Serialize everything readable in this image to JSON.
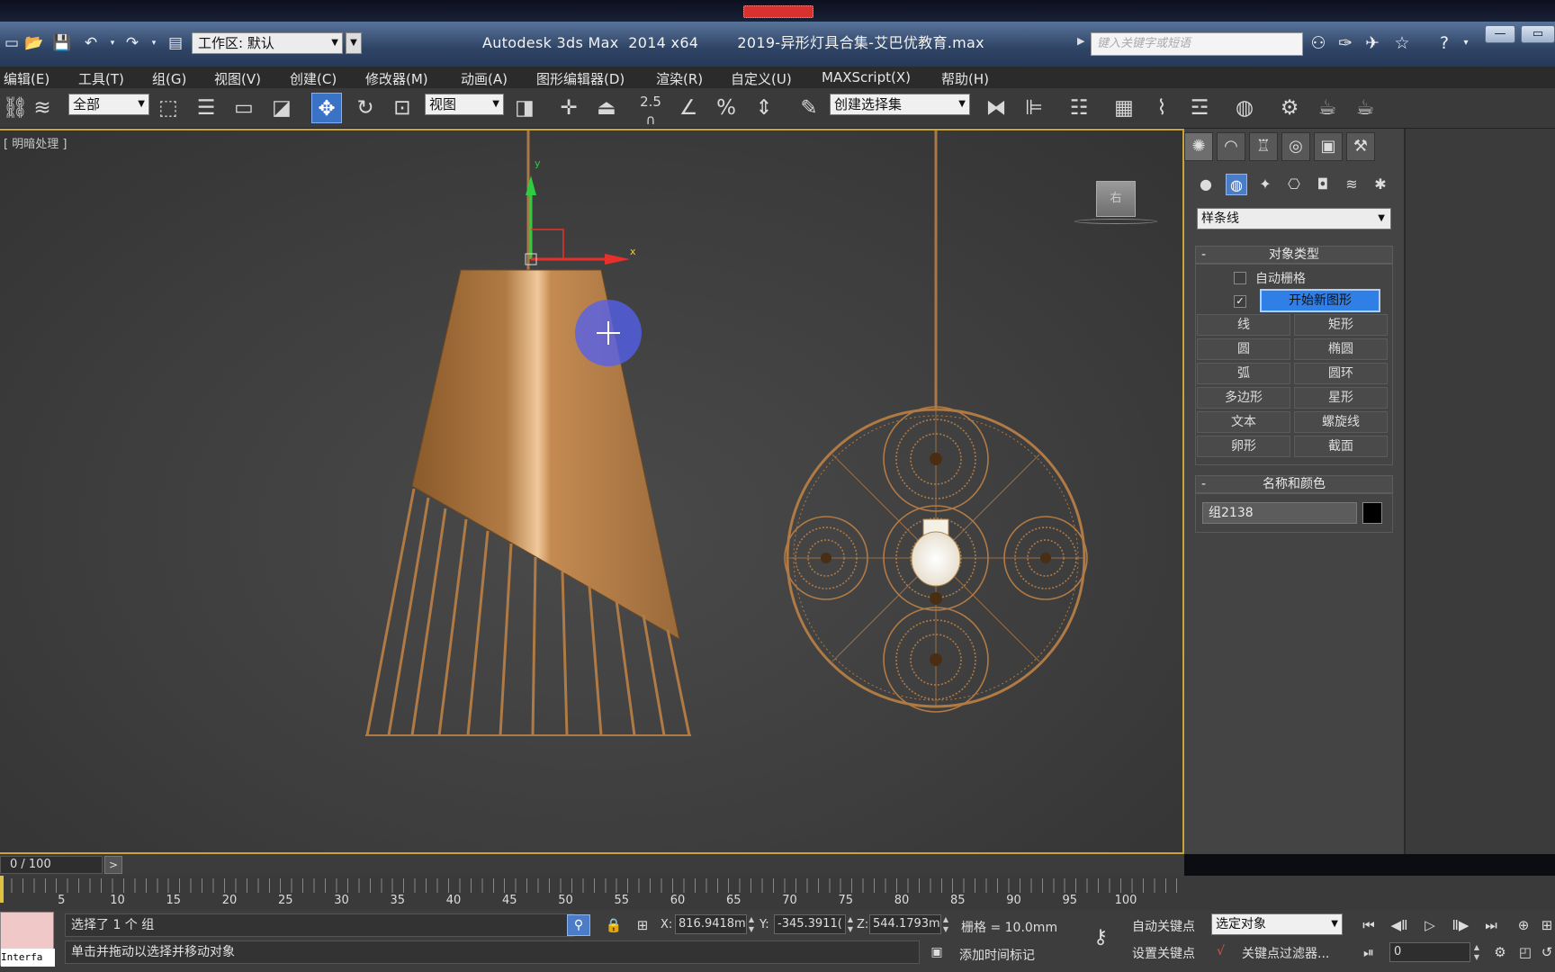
{
  "title_bar": {
    "app_title": "Autodesk 3ds Max  2014 x64",
    "file_name": "2019-异形灯具合集-艾巴优教育.max",
    "workspace_label": "工作区: 默认",
    "search_placeholder": "键入关键字或短语"
  },
  "menu": [
    "编辑(E)",
    "工具(T)",
    "组(G)",
    "视图(V)",
    "创建(C)",
    "修改器(M)",
    "动画(A)",
    "图形编辑器(D)",
    "渲染(R)",
    "自定义(U)",
    "MAXScript(X)",
    "帮助(H)"
  ],
  "toolbar": {
    "filter_value": "全部",
    "ref_coord_value": "视图",
    "snap_value": "2.5",
    "named_selection_value": "创建选择集"
  },
  "viewport": {
    "label": "[ 明暗处理 ]",
    "viewcube_label": "右"
  },
  "command_panel": {
    "category": "样条线",
    "object_type_header": "对象类型",
    "auto_grid_label": "自动栅格",
    "start_new_shape_label": "开始新图形",
    "start_new_shape_checked": true,
    "buttons": [
      [
        "线",
        "矩形"
      ],
      [
        "圆",
        "椭圆"
      ],
      [
        "弧",
        "圆环"
      ],
      [
        "多边形",
        "星形"
      ],
      [
        "文本",
        "螺旋线"
      ],
      [
        "卵形",
        "截面"
      ]
    ],
    "name_color_header": "名称和颜色",
    "object_name": "组2138",
    "object_color": "#000000"
  },
  "time_slider": {
    "frame_display": "0 / 100",
    "next_label": ">"
  },
  "trackbar": {
    "ticks": [
      "5",
      "10",
      "15",
      "20",
      "25",
      "30",
      "35",
      "40",
      "45",
      "50",
      "55",
      "60",
      "65",
      "70",
      "75",
      "80",
      "85",
      "90",
      "95",
      "100"
    ]
  },
  "status": {
    "maxscript_label": "Interfa",
    "selection_info": "选择了 1 个 组",
    "prompt": "单击并拖动以选择并移动对象",
    "x_label": "X:",
    "x_value": "816.9418m",
    "y_label": "Y:",
    "y_value": "-345.3911(",
    "z_label": "Z:",
    "z_value": "544.1793m",
    "grid": "栅格 = 10.0mm",
    "add_time_tag": "添加时间标记",
    "auto_key": "自动关键点",
    "set_key": "设置关键点",
    "selected_objects": "选定对象",
    "key_filters": "关键点过滤器...",
    "current_frame": "0"
  }
}
